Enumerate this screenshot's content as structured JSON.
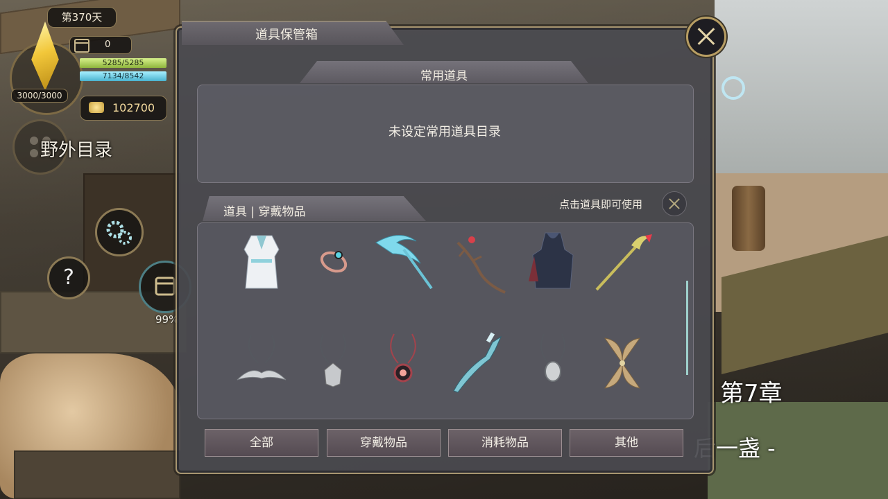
{
  "hud": {
    "day": "第370天",
    "counter": "0",
    "hp_cap": "3000/3000",
    "hp_bar": "5285/5285",
    "mp_bar": "7134/8542",
    "gold": "102700",
    "field_menu": "野外目录",
    "progress_pct": "99%",
    "chapter": "第7章",
    "subtitle": "后一盏 -"
  },
  "modal": {
    "title": "道具保管箱",
    "quick_section_label": "常用道具",
    "quick_empty_text": "未设定常用道具目录",
    "items_tab_label": "道具 | 穿戴物品",
    "hint": "点击道具即可使用",
    "items": [
      {
        "icon": "white-robe-icon"
      },
      {
        "icon": "ring-icon"
      },
      {
        "icon": "ice-scythe-icon"
      },
      {
        "icon": "branch-staff-icon"
      },
      {
        "icon": "dark-armor-icon"
      },
      {
        "icon": "golden-staff-icon"
      },
      {
        "icon": "wing-necklace-icon"
      },
      {
        "icon": "silver-pendant-icon"
      },
      {
        "icon": "red-pendant-icon"
      },
      {
        "icon": "ice-blade-icon"
      },
      {
        "icon": "oval-pendant-icon"
      },
      {
        "icon": "leaf-emblem-icon"
      }
    ],
    "filters": [
      "全部",
      "穿戴物品",
      "消耗物品",
      "其他"
    ]
  },
  "colors": {
    "frame_gold": "#b79d63",
    "hp_green": "#b7d85f",
    "mp_cyan": "#6ec8de",
    "panel": "#4a4a50"
  }
}
